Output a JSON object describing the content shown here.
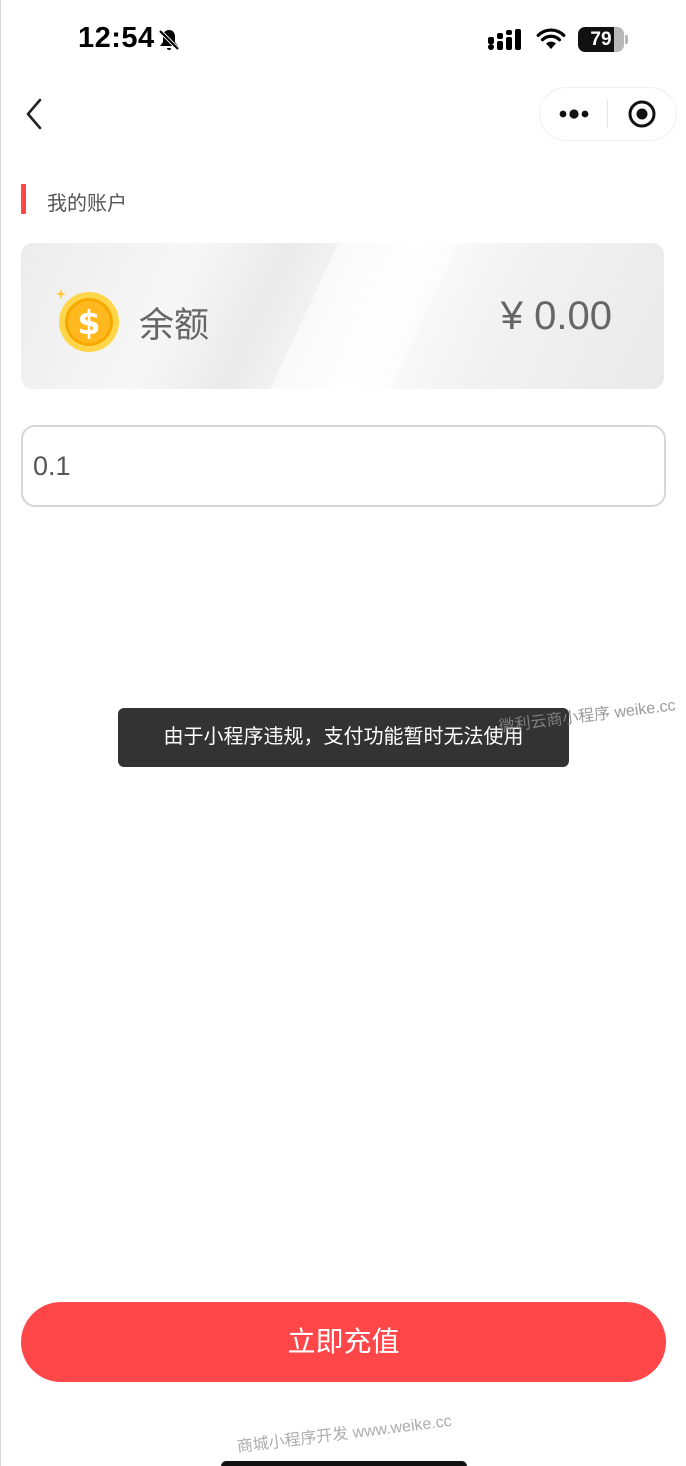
{
  "status_bar": {
    "time": "12:54",
    "battery": "79",
    "battery_level": 0.79,
    "icons": [
      "bell-slash-icon",
      "signal-icon",
      "wifi-icon",
      "battery-icon"
    ]
  },
  "nav": {
    "back_icon": "chevron-left-icon",
    "more_icon": "more-dots-icon",
    "close_icon": "target-circle-icon"
  },
  "section": {
    "title": "我的账户"
  },
  "balance_card": {
    "label": "余额",
    "amount": "¥ 0.00",
    "icon": "coin-dollar-icon"
  },
  "amount_input": {
    "value": "0.1"
  },
  "toast": {
    "message": "由于小程序违规，支付功能暂时无法使用"
  },
  "watermarks": {
    "top": "微利云商小程序 weike.cc",
    "bottom": "商城小程序开发 www.weike.cc"
  },
  "actions": {
    "recharge_label": "立即充值"
  },
  "colors": {
    "accent": "#ff474a",
    "toast_bg": "#282828"
  }
}
